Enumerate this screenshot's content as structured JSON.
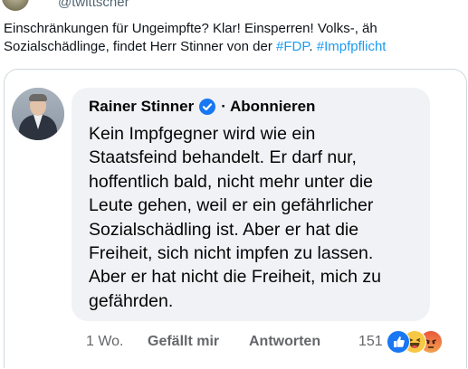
{
  "tweet": {
    "handle": "@twittscher",
    "text_plain": "Einschränkungen für Ungeimpfte? Klar! Einsperren! Volks-, äh Sozialschädlinge, findet Herr Stinner von der ",
    "hashtag_1": "#FDP",
    "separator": ". ",
    "hashtag_2": "#Impfpflicht",
    "accent_color": "#1d9bf0"
  },
  "facebook_comment": {
    "author_name": "Rainer Stinner",
    "verified_icon": "verified-badge-icon",
    "follow_label": "· Abonnieren",
    "comment_text": "Kein Impfgegner wird wie ein\nStaatsfeind behandelt. Er darf nur,\nhoffentlich bald, nicht mehr unter die\nLeute gehen, weil er ein gefährlicher\nSozialschädling ist. Aber er hat die\nFreiheit, sich nicht impfen zu lassen.\nAber er hat nicht die Freiheit, mich zu\ngefährden.",
    "time_ago": "1 Wo.",
    "like_label": "Gefällt mir",
    "reply_label": "Antworten",
    "reaction_count": "151",
    "reactions": [
      "like-reaction-icon",
      "haha-reaction-icon",
      "angry-reaction-icon"
    ],
    "bubble_color": "#f0f2f5"
  }
}
